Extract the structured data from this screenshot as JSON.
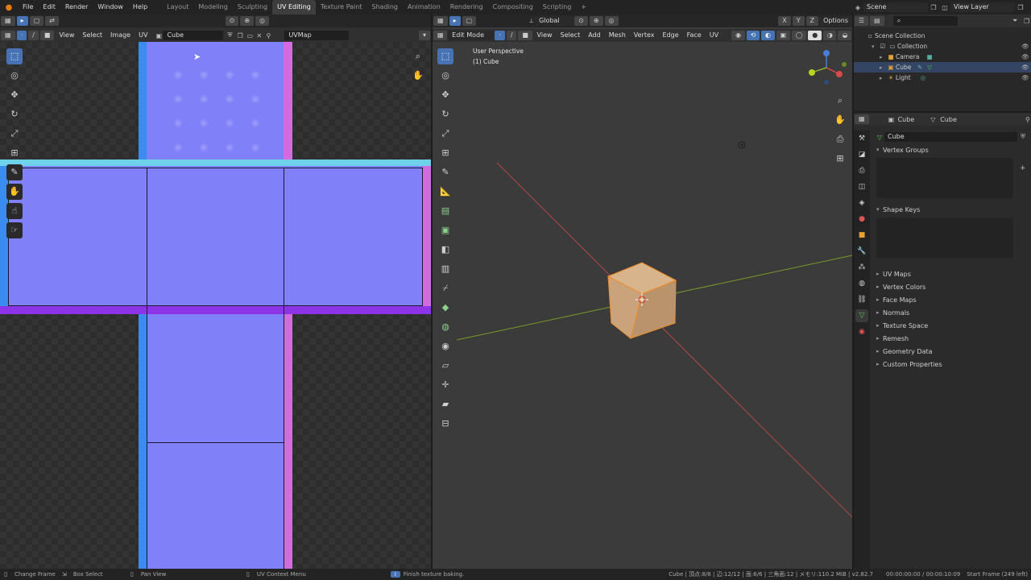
{
  "topbar": {
    "menus": [
      "File",
      "Edit",
      "Render",
      "Window",
      "Help"
    ],
    "workspaces": [
      "Layout",
      "Modeling",
      "Sculpting",
      "UV Editing",
      "Texture Paint",
      "Shading",
      "Animation",
      "Rendering",
      "Compositing",
      "Scripting"
    ],
    "active_workspace": "UV Editing",
    "add_tab": "+",
    "scene": "Scene",
    "view_layer": "View Layer"
  },
  "uv_editor": {
    "menus": [
      "View",
      "Select",
      "Image",
      "UV"
    ],
    "image_name": "Cube",
    "uvmap": "UVMap"
  },
  "viewport": {
    "mode": "Edit Mode",
    "menus": [
      "View",
      "Select",
      "Add",
      "Mesh",
      "Vertex",
      "Edge",
      "Face",
      "UV"
    ],
    "transform": "Global",
    "options": "Options",
    "overlay_title": "User Perspective",
    "overlay_object": "(1) Cube"
  },
  "outliner": {
    "root": "Scene Collection",
    "collection": "Collection",
    "items": [
      "Camera",
      "Cube",
      "Light"
    ]
  },
  "properties": {
    "object_name": "Cube",
    "mesh_name": "Cube",
    "data_name": "Cube",
    "sections_open": [
      "Vertex Groups",
      "Shape Keys"
    ],
    "sections_closed": [
      "UV Maps",
      "Vertex Colors",
      "Face Maps",
      "Normals",
      "Texture Space",
      "Remesh",
      "Geometry Data",
      "Custom Properties"
    ]
  },
  "statusbar": {
    "left": [
      "Change Frame",
      "Box Select",
      "Pan View",
      "UV Context Menu"
    ],
    "message": "Finish texture baking.",
    "stats": "Cube | 頂点:8/8 | 辺:12/12 | 面:6/6 | 三角面:12 | メモリ:110.2 MiB | v2.82.7",
    "timecode": "00:00:00:00 / 00:00:10:09",
    "start_frame": "Start Frame (249 left)"
  },
  "colors": {
    "accent": "#4772b3",
    "uv_fill": "#8080f8",
    "cube": "#c9a37c",
    "selection": "#f08c2a"
  }
}
